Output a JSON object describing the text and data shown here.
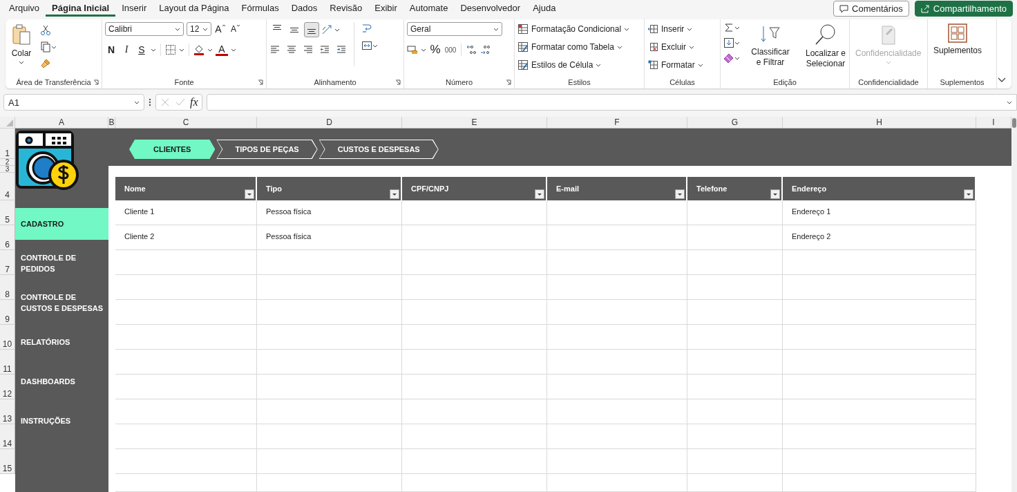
{
  "menu": {
    "tabs": [
      {
        "label": "Arquivo",
        "selected": false
      },
      {
        "label": "Página Inicial",
        "selected": true
      },
      {
        "label": "Inserir",
        "selected": false
      },
      {
        "label": "Layout da Página",
        "selected": false
      },
      {
        "label": "Fórmulas",
        "selected": false
      },
      {
        "label": "Dados",
        "selected": false
      },
      {
        "label": "Revisão",
        "selected": false
      },
      {
        "label": "Exibir",
        "selected": false
      },
      {
        "label": "Automate",
        "selected": false
      },
      {
        "label": "Desenvolvedor",
        "selected": false
      },
      {
        "label": "Ajuda",
        "selected": false
      }
    ],
    "comments_button": "Comentários",
    "share_button": "Compartilhamento"
  },
  "ribbon": {
    "clipboard": {
      "paste": "Colar",
      "label": "Área de Transferência"
    },
    "font": {
      "family": "Calibri",
      "size": "12",
      "grow": "A",
      "shrink": "A",
      "bold": "N",
      "italic": "I",
      "underline": "S",
      "color_button": "A",
      "label": "Fonte"
    },
    "alignment": {
      "vertical": [
        {
          "selected": false
        },
        {
          "selected": false
        },
        {
          "selected": true
        }
      ],
      "label": "Alinhamento"
    },
    "number": {
      "format": "Geral",
      "percent": "%",
      "thousands": "000",
      "label": "Número"
    },
    "styles": {
      "items": [
        "Formatação Condicional",
        "Formatar como Tabela",
        "Estilos de Célula"
      ],
      "label": "Estilos"
    },
    "cells": {
      "items": [
        "Inserir",
        "Excluir",
        "Formatar"
      ],
      "label": "Células"
    },
    "editing": {
      "sort": "Classificar e Filtrar",
      "find": "Localizar e Selecionar",
      "label": "Edição"
    },
    "sensitivity": {
      "button": "Confidencialidade",
      "disabled": true,
      "label": "Confidencialidade"
    },
    "addins": {
      "button": "Suplementos",
      "label": "Suplementos"
    }
  },
  "formula_bar": {
    "name_box": "A1",
    "fx": "fx"
  },
  "sheet": {
    "columns": [
      "A",
      "B",
      "C",
      "D",
      "E",
      "F",
      "G",
      "H",
      "I"
    ],
    "rows": [
      "1",
      "2",
      "3",
      "4",
      "5",
      "6",
      "7",
      "8",
      "9",
      "10",
      "11",
      "12",
      "13",
      "14",
      "15"
    ],
    "tabs": [
      {
        "label": "CLIENTES",
        "selected": true
      },
      {
        "label": "TIPOS DE PEÇAS",
        "selected": false
      },
      {
        "label": "CUSTOS E DESPESAS",
        "selected": false
      }
    ],
    "sidebar": [
      {
        "label": "CADASTRO",
        "selected": true
      },
      {
        "label": "CONTROLE DE PEDIDOS",
        "selected": false
      },
      {
        "label": "CONTROLE DE CUSTOS E DESPESAS",
        "selected": false
      },
      {
        "label": "RELATÓRIOS",
        "selected": false
      },
      {
        "label": "DASHBOARDS",
        "selected": false
      },
      {
        "label": "INSTRUÇÕES",
        "selected": false
      }
    ],
    "table": {
      "columns": [
        "Nome",
        "Tipo",
        "CPF/CNPJ",
        "E-mail",
        "Telefone",
        "Endereço"
      ],
      "rows": [
        {
          "nome": "Cliente 1",
          "tipo": "Pessoa física",
          "endereco": "Endereço 1"
        },
        {
          "nome": "Cliente 2",
          "tipo": "Pessoa física",
          "endereco": "Endereço 2"
        }
      ]
    }
  }
}
